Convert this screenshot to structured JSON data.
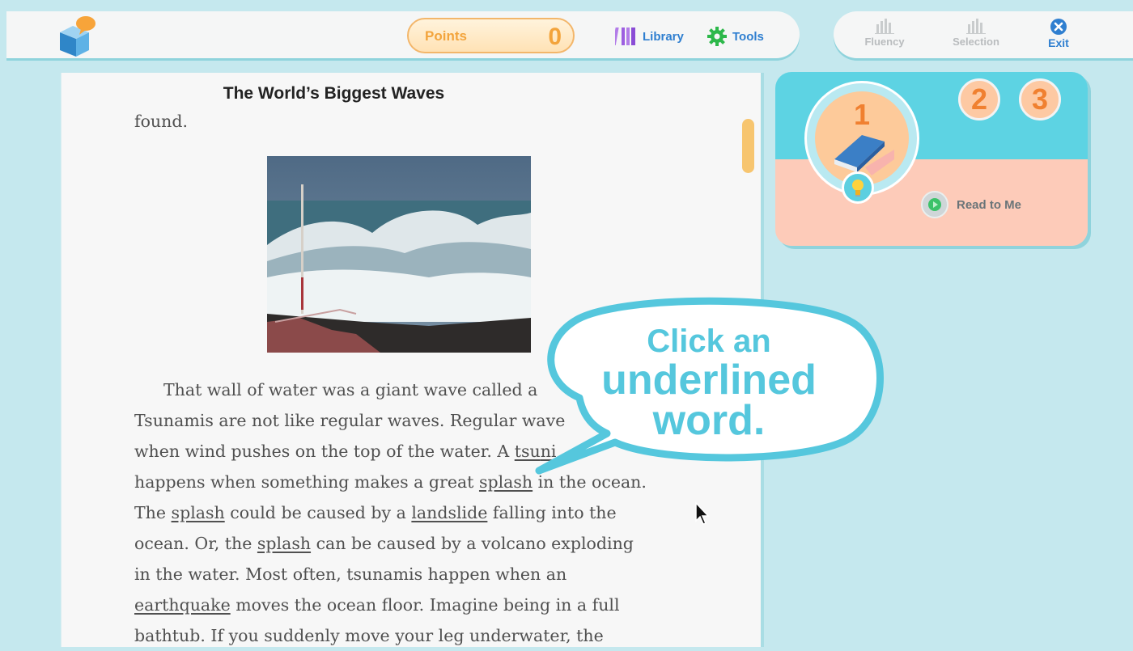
{
  "header": {
    "points_label": "Points",
    "points_value": "0",
    "library_label": "Library",
    "tools_label": "Tools",
    "fluency_label": "Fluency",
    "selection_label": "Selection",
    "exit_label": "Exit"
  },
  "reader": {
    "title": "The World’s Biggest Waves",
    "text_fragment_top": "found.",
    "paragraph_lines": [
      "That wall of water was a giant wave called a",
      "Tsunamis are not like regular waves. Regular wave",
      "when wind pushes on the top of the water. A",
      "happens when something makes a great",
      "The",
      "ocean. Or, the",
      "in the water. Most often, tsunamis happen when an",
      "moves the ocean floor. Imagine being in a full",
      "bathtub. If you suddenly move your leg underwater, the"
    ],
    "words": {
      "tsunami_partial": "tsu",
      "tsunami_tail": "ni",
      "splash": "splash",
      "in_the_ocean": " in the ocean.",
      "could_be": " could be caused by a ",
      "landslide": "landslide",
      "falling": " falling into the",
      "can_be": " can be caused by a volcano exploding",
      "earthquake": "earthquake"
    }
  },
  "callout": {
    "line1": "Click an",
    "line2": "underlined",
    "line3": "word."
  },
  "activity": {
    "step1": "1",
    "step2": "2",
    "step3": "3",
    "read_to_me_label": "Read to Me"
  },
  "icons": [
    "logo-book-icon",
    "library-books-icon",
    "gear-icon",
    "bar-chart-icon",
    "close-circle-icon",
    "book-icon",
    "lightbulb-icon",
    "play-icon",
    "mouse-cursor-icon"
  ],
  "colors": {
    "accent_blue": "#2f7fd0",
    "points_orange": "#f3a43c",
    "callout_cyan": "#55c7dd",
    "card_top": "#5dd3e3",
    "card_bottom": "#fdcbb9",
    "step_orange": "#f08030"
  }
}
